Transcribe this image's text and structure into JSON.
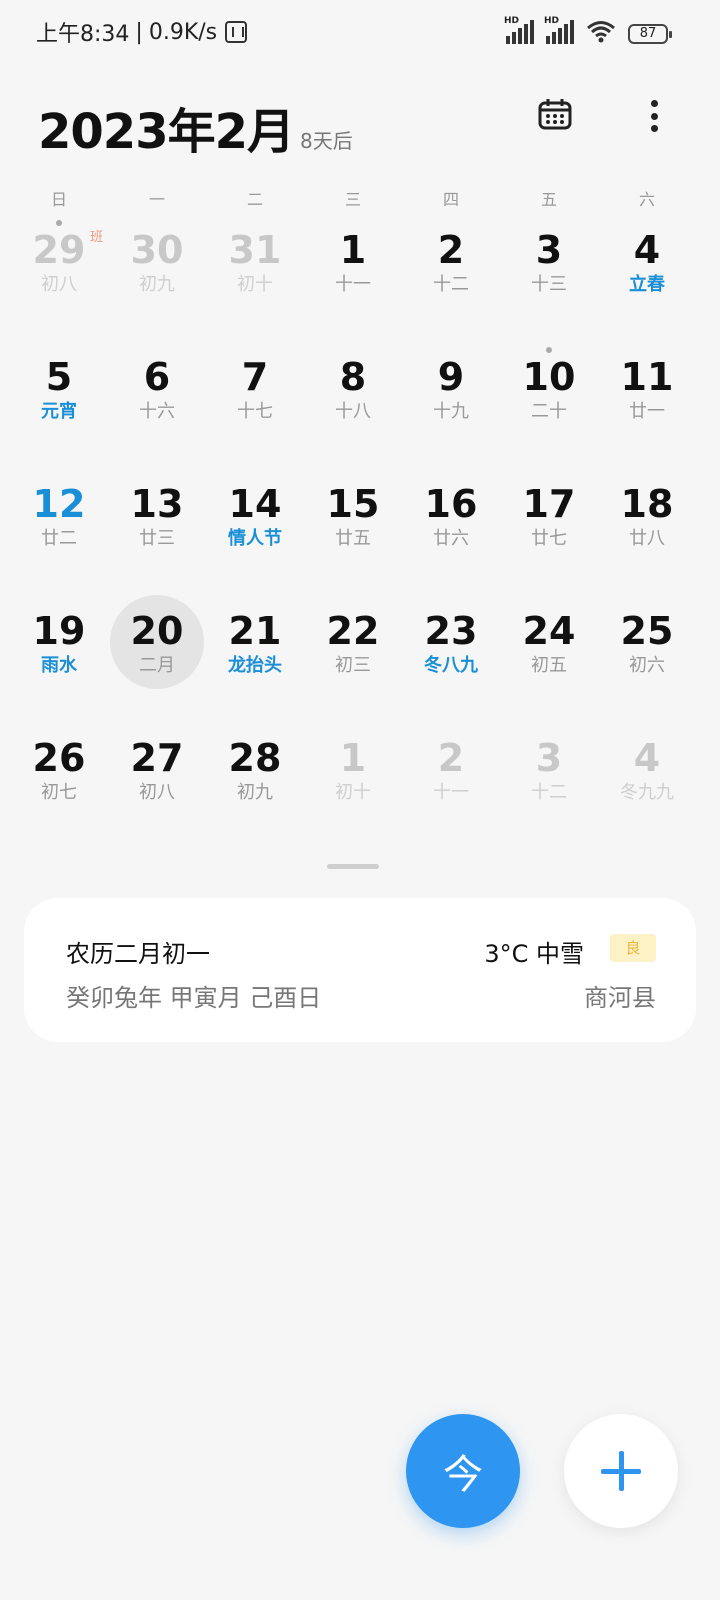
{
  "status_bar": {
    "time": "上午8:34",
    "net_speed": "0.9K/s",
    "battery": "87",
    "hd_label": "HD"
  },
  "header": {
    "title": "2023年2月",
    "relative": "8天后"
  },
  "weekdays": [
    "日",
    "一",
    "二",
    "三",
    "四",
    "五",
    "六"
  ],
  "weeks": [
    [
      {
        "day": "29",
        "lunar": "初八",
        "muted": true,
        "dot": true,
        "badge": "班"
      },
      {
        "day": "30",
        "lunar": "初九",
        "muted": true
      },
      {
        "day": "31",
        "lunar": "初十",
        "muted": true
      },
      {
        "day": "1",
        "lunar": "十一"
      },
      {
        "day": "2",
        "lunar": "十二"
      },
      {
        "day": "3",
        "lunar": "十三"
      },
      {
        "day": "4",
        "lunar": "立春",
        "festival": true
      }
    ],
    [
      {
        "day": "5",
        "lunar": "元宵",
        "festival": true
      },
      {
        "day": "6",
        "lunar": "十六"
      },
      {
        "day": "7",
        "lunar": "十七"
      },
      {
        "day": "8",
        "lunar": "十八"
      },
      {
        "day": "9",
        "lunar": "十九"
      },
      {
        "day": "10",
        "lunar": "二十",
        "dot": true
      },
      {
        "day": "11",
        "lunar": "廿一"
      }
    ],
    [
      {
        "day": "12",
        "lunar": "廿二",
        "blue": true
      },
      {
        "day": "13",
        "lunar": "廿三"
      },
      {
        "day": "14",
        "lunar": "情人节",
        "festival": true
      },
      {
        "day": "15",
        "lunar": "廿五"
      },
      {
        "day": "16",
        "lunar": "廿六"
      },
      {
        "day": "17",
        "lunar": "廿七"
      },
      {
        "day": "18",
        "lunar": "廿八"
      }
    ],
    [
      {
        "day": "19",
        "lunar": "雨水",
        "festival": true
      },
      {
        "day": "20",
        "lunar": "二月",
        "selected": true
      },
      {
        "day": "21",
        "lunar": "龙抬头",
        "festival": true
      },
      {
        "day": "22",
        "lunar": "初三"
      },
      {
        "day": "23",
        "lunar": "冬八九",
        "festival": true
      },
      {
        "day": "24",
        "lunar": "初五"
      },
      {
        "day": "25",
        "lunar": "初六"
      }
    ],
    [
      {
        "day": "26",
        "lunar": "初七"
      },
      {
        "day": "27",
        "lunar": "初八"
      },
      {
        "day": "28",
        "lunar": "初九"
      },
      {
        "day": "1",
        "lunar": "初十",
        "muted": true
      },
      {
        "day": "2",
        "lunar": "十一",
        "muted": true
      },
      {
        "day": "3",
        "lunar": "十二",
        "muted": true
      },
      {
        "day": "4",
        "lunar": "冬九九",
        "muted": true
      }
    ]
  ],
  "info_card": {
    "lunar_date": "农历二月初一",
    "ganzhi": "癸卯兔年 甲寅月 己酉日",
    "weather": "3°C 中雪",
    "aqi": "良",
    "location": "商河县"
  },
  "fab": {
    "today_label": "今",
    "add_icon": "plus-icon"
  },
  "colors": {
    "accent": "#2e95f0",
    "festival": "#1a8fd8",
    "work_badge": "#f09a80"
  }
}
